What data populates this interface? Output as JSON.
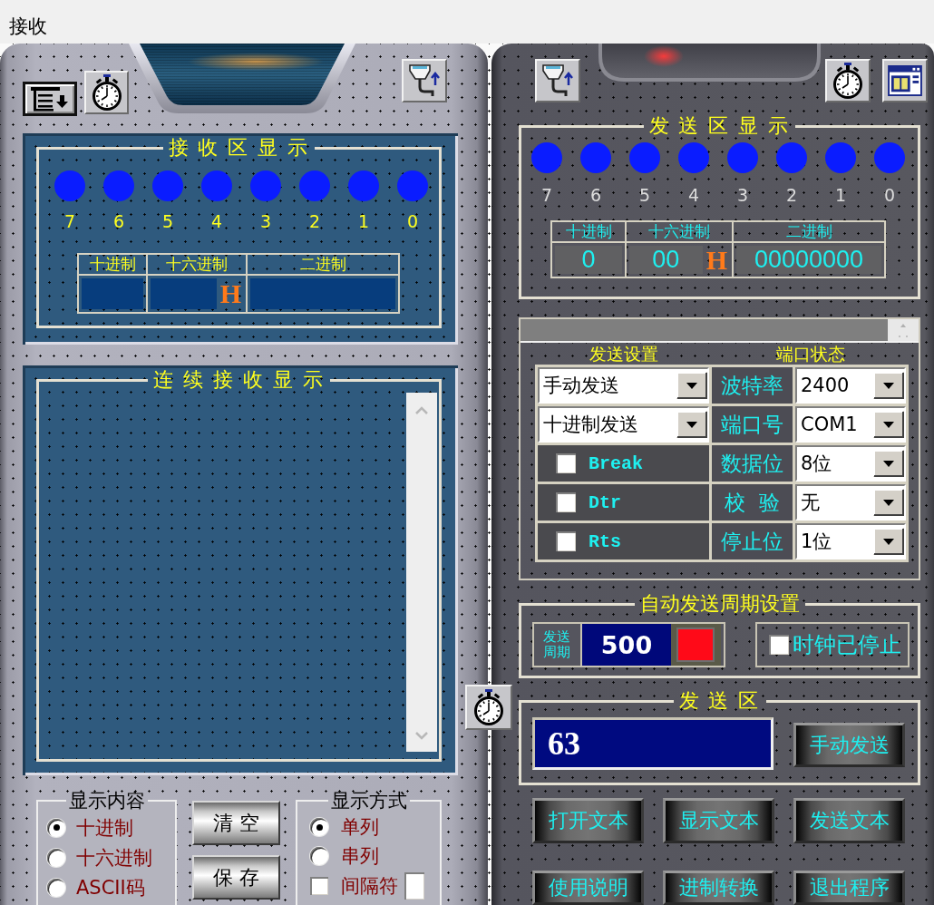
{
  "window": {
    "title": "接收"
  },
  "receive_display": {
    "title": "接 收 区 显 示",
    "bits": [
      {
        "label": "7",
        "on": false
      },
      {
        "label": "6",
        "on": false
      },
      {
        "label": "5",
        "on": false
      },
      {
        "label": "4",
        "on": false
      },
      {
        "label": "3",
        "on": false
      },
      {
        "label": "2",
        "on": false
      },
      {
        "label": "1",
        "on": false
      },
      {
        "label": "0",
        "on": false
      }
    ],
    "columns": [
      "十进制",
      "十六进制",
      "二进制"
    ],
    "hex_suffix": "H"
  },
  "continuous_receive": {
    "title": "连 续 接 收 显 示"
  },
  "display_content": {
    "title": "显示内容",
    "options": [
      {
        "label": "十进制",
        "selected": true
      },
      {
        "label": "十六进制",
        "selected": false
      },
      {
        "label": "ASCII码",
        "selected": false
      }
    ]
  },
  "receive_buttons": [
    "清 空",
    "保 存"
  ],
  "display_mode": {
    "title": "显示方式",
    "options": [
      {
        "label": "单列",
        "selected": true
      },
      {
        "label": "串列",
        "selected": false
      }
    ],
    "separator": {
      "label": "间隔符",
      "checked": false
    }
  },
  "send_display": {
    "title": "发 送 区 显 示",
    "bits": [
      {
        "label": "7",
        "on": false
      },
      {
        "label": "6",
        "on": false
      },
      {
        "label": "5",
        "on": false
      },
      {
        "label": "4",
        "on": false
      },
      {
        "label": "3",
        "on": false
      },
      {
        "label": "2",
        "on": false
      },
      {
        "label": "1",
        "on": false
      },
      {
        "label": "0",
        "on": false
      }
    ],
    "columns": [
      "十进制",
      "十六进制",
      "二进制"
    ],
    "decimal": "0",
    "hex": "00",
    "hex_suffix": "H",
    "binary": "00000000"
  },
  "settings": {
    "send_title": "发送设置",
    "port_title": "端口状态",
    "send_items": [
      {
        "kind": "select",
        "value": "手动发送"
      },
      {
        "kind": "select",
        "value": "十进制发送"
      },
      {
        "kind": "checkbox",
        "label": "Break",
        "checked": false
      },
      {
        "kind": "checkbox",
        "label": "Dtr",
        "checked": false
      },
      {
        "kind": "checkbox",
        "label": "Rts",
        "checked": false
      }
    ],
    "port_items": [
      {
        "label": "波特率",
        "value": "2400"
      },
      {
        "label": "端口号",
        "value": "COM1"
      },
      {
        "label": "数据位",
        "value": "8位"
      },
      {
        "label": "校  验",
        "value": "无"
      },
      {
        "label": "停止位",
        "value": "1位"
      }
    ]
  },
  "auto_send": {
    "title": "自动发送周期设置",
    "period_label": "发送周期",
    "period": "500",
    "clock": {
      "label": "时钟已停止",
      "checked": false
    }
  },
  "send_area": {
    "title": "发 送 区",
    "value": "63",
    "button": "手动发送"
  },
  "actions": [
    "打开文本",
    "显示文本",
    "发送文本",
    "使用说明",
    "进制转换",
    "退出程序"
  ]
}
